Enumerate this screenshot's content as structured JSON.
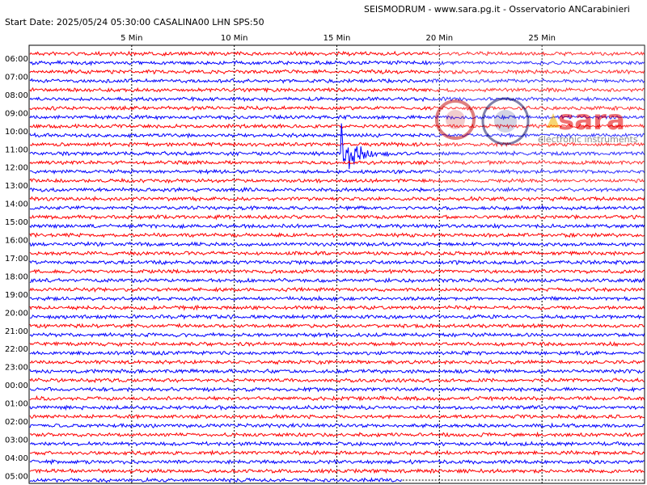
{
  "header": {
    "title": "SEISMODRUM - www.sara.pg.it - Osservatorio ANCarabinieri",
    "start_line": "Start Date: 2025/05/24 05:30:00 CASALINA00 LHN  SPS:50"
  },
  "logo": {
    "text": "sara",
    "subtext": "electronic instruments"
  },
  "colors": {
    "line_a": "#ff0000",
    "line_b": "#0000ff",
    "frame": "#000000"
  },
  "chart_data": {
    "type": "line",
    "title": "SEISMODRUM - www.sara.pg.it - Osservatorio ANCarabinieri",
    "x_ticks": [
      "5 Min",
      "10 Min",
      "15 Min",
      "20 Min",
      "25 Min"
    ],
    "x_tick_minutes": [
      5,
      10,
      15,
      20,
      25
    ],
    "x_range_minutes": [
      0,
      30
    ],
    "row_labels": [
      "06:00",
      "07:00",
      "08:00",
      "09:00",
      "10:00",
      "11:00",
      "12:00",
      "13:00",
      "14:00",
      "15:00",
      "16:00",
      "17:00",
      "18:00",
      "19:00",
      "20:00",
      "21:00",
      "22:00",
      "23:00",
      "00:00",
      "01:00",
      "02:00",
      "03:00",
      "04:00",
      "05:00"
    ],
    "traces_per_label": 2,
    "trace_colors_alternate": [
      "red",
      "blue"
    ],
    "grid": "vertical dashed at each 5 min",
    "events": [
      {
        "label_row": "11:00",
        "start_minute": 15.2,
        "end_minute": 17.5,
        "description": "earthquake burst"
      }
    ],
    "last_trace_end_minute": 18.2
  }
}
